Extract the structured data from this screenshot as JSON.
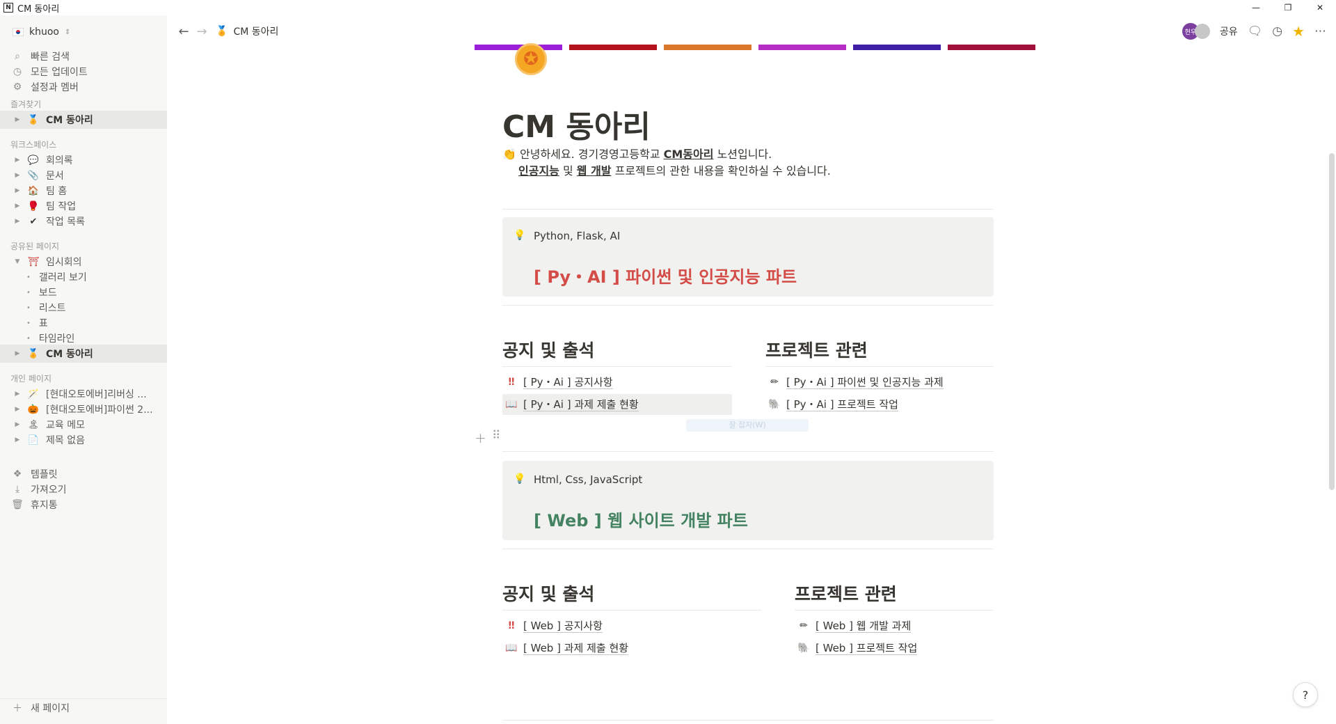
{
  "window": {
    "title": "CM 동아리",
    "app_icon": "N"
  },
  "sidebar": {
    "workspace": "khuoo",
    "top_items": [
      {
        "icon": "search-icon",
        "label": "빠른 검색"
      },
      {
        "icon": "clock-icon",
        "label": "모든 업데이트"
      },
      {
        "icon": "gear-icon",
        "label": "설정과 멤버"
      }
    ],
    "sections": {
      "favorites": "즐겨찾기",
      "workspace": "워크스페이스",
      "shared": "공유된 페이지",
      "private": "개인 페이지"
    },
    "favorites": [
      {
        "emoji": "🏅",
        "label": "CM 동아리"
      }
    ],
    "workspace_items": [
      {
        "emoji": "💬",
        "label": "회의록"
      },
      {
        "emoji": "📎",
        "label": "문서"
      },
      {
        "emoji": "🏠",
        "label": "팀 홈"
      },
      {
        "emoji": "🥊",
        "label": "팀 작업"
      },
      {
        "emoji": "✔",
        "label": "작업 목록"
      }
    ],
    "shared_items": [
      {
        "emoji": "⛩",
        "label": "임시회의"
      },
      {
        "label": "갤러리 보기"
      },
      {
        "label": "보드"
      },
      {
        "label": "리스트"
      },
      {
        "label": "표"
      },
      {
        "label": "타임라인"
      },
      {
        "emoji": "🏅",
        "label": "CM 동아리"
      }
    ],
    "private_items": [
      {
        "emoji": "🪄",
        "label": "[현대오토에버]리버싱 ..."
      },
      {
        "emoji": "🎃",
        "label": "[현대오토에버]파이썬 2..."
      },
      {
        "emoji": "🏝",
        "label": "교육 메모"
      },
      {
        "emoji": "📄",
        "label": "제목 없음"
      }
    ],
    "bottom_items": [
      {
        "icon": "template-icon",
        "label": "템플릿"
      },
      {
        "icon": "import-icon",
        "label": "가져오기"
      },
      {
        "icon": "trash-icon",
        "label": "휴지통"
      }
    ],
    "new_page": "새 페이지"
  },
  "topbar": {
    "breadcrumb_emoji": "🏅",
    "breadcrumb": "CM 동아리",
    "avatar_text": "현우",
    "share": "공유"
  },
  "page": {
    "icon": "✪",
    "title": "CM 동아리",
    "intro_emoji": "👏",
    "intro_line1_pre": "안녕하세요. 경기경영고등학교 ",
    "intro_line1_link": "CM동아리",
    "intro_line1_post": " 노션입니다.",
    "intro_line2_link1": "인공지능",
    "intro_line2_mid": " 및 ",
    "intro_line2_link2": "웹 개발",
    "intro_line2_post": " 프로젝트의 관한 내용을 확인하실 수 있습니다.",
    "callout_py": {
      "subtitle": "Python, Flask, AI",
      "heading": "[ Py・AI ] 파이썬 및 인공지능 파트",
      "color": "#d44c47"
    },
    "py_left_heading": "공지 및 출석",
    "py_right_heading": "프로젝트 관련",
    "py_left_links": [
      {
        "emoji": "‼",
        "label": "[ Py・Ai ] 공지사항"
      },
      {
        "emoji": "📖",
        "label": "[ Py・Ai ] 과제 제출 현황"
      }
    ],
    "py_right_links": [
      {
        "emoji": "✏",
        "label": "[ Py・Ai ] 파이썬 및 인공지능 과제"
      },
      {
        "emoji": "🐘",
        "label": "[ Py・Ai ] 프로젝트 작업"
      }
    ],
    "drag_tip": "잘 잡자(W)",
    "callout_web": {
      "subtitle": "Html, Css, JavaScript",
      "heading": "[ Web ] 웹 사이트 개발 파트",
      "color": "#448361"
    },
    "web_left_heading": "공지 및 출석",
    "web_right_heading": "프로젝트 관련",
    "web_left_links": [
      {
        "emoji": "‼",
        "label": "[ Web ] 공지사항"
      },
      {
        "emoji": "📖",
        "label": "[ Web ] 과제 제출 현황"
      }
    ],
    "web_right_links": [
      {
        "emoji": "✏",
        "label": "[ Web ] 웹 개발 과제"
      },
      {
        "emoji": "🐘",
        "label": "[ Web ] 프로젝트 작업"
      }
    ]
  },
  "help": "?",
  "colors": {
    "sidebar_bg": "#f7f7f5",
    "callout_bg": "#f1f1ef",
    "favorite_star": "#f0b400"
  }
}
